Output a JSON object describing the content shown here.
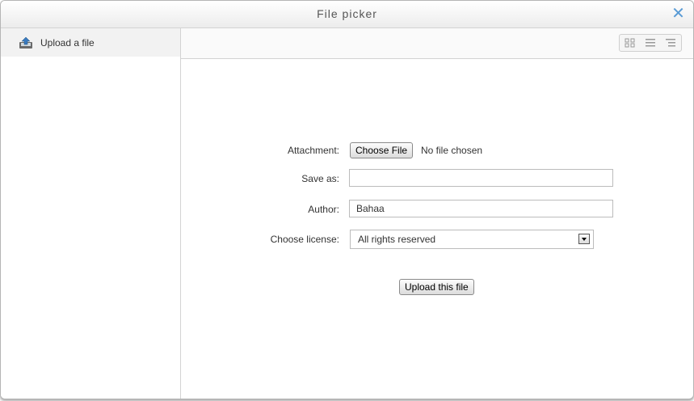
{
  "dialog": {
    "title": "File picker",
    "close_symbol": "✕"
  },
  "sidebar": {
    "items": [
      {
        "label": "Upload a file",
        "icon": "upload-icon"
      }
    ]
  },
  "toolbar": {
    "views": [
      "icons-view-icon",
      "list-view-icon",
      "tree-view-icon"
    ]
  },
  "form": {
    "attachment_label": "Attachment:",
    "choose_file_label": "Choose File",
    "no_file_text": "No file chosen",
    "save_as_label": "Save as:",
    "save_as_value": "",
    "author_label": "Author:",
    "author_value": "Bahaa",
    "license_label": "Choose license:",
    "license_value": "All rights reserved",
    "upload_button_label": "Upload this file"
  },
  "colors": {
    "accent": "#5a9bd5",
    "sidebar_selected_bg": "#f2f2f2"
  }
}
